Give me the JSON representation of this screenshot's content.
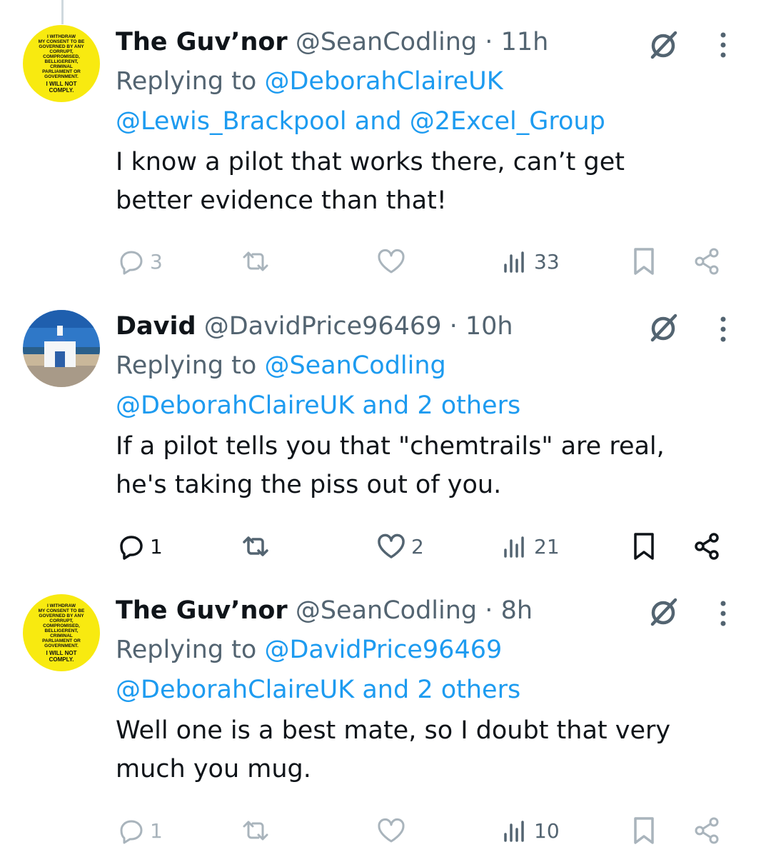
{
  "tweets": [
    {
      "avatar": {
        "lines": [
          "I WITHDRAW",
          "MY CONSENT TO BE",
          "GOVERNED BY ANY",
          "CORRUPT, COMPROMISED,",
          "BELLIGERENT, CRIMINAL",
          "PARLIAMENT OR",
          "GOVERNMENT."
        ],
        "footer": [
          "I WILL NOT",
          "COMPLY."
        ]
      },
      "name": "The Guv’nor",
      "handle": "@SeanCodling",
      "separator": "·",
      "time": "11h",
      "reply_prefix": "Replying to",
      "reply_line1": "@DeborahClaireUK",
      "reply_line2_a": "@Lewis_Brackpool",
      "reply_line2_and": "and",
      "reply_line2_b": "@2Excel_Group",
      "body_lines": [
        "I know a pilot that works there, can’t get",
        "better evidence than that!"
      ],
      "replies": "3",
      "retweets": "",
      "likes": "",
      "views": "33"
    },
    {
      "name": "David",
      "handle": "@DavidPrice96469",
      "separator": "·",
      "time": "10h",
      "reply_prefix": "Replying to",
      "reply_line1": "@SeanCodling",
      "reply_line2_a": "@DeborahClaireUK",
      "reply_line2_and": "and 2 others",
      "body_lines": [
        "If a pilot tells you that \"chemtrails\" are real,",
        "he's taking the piss out of you."
      ],
      "replies": "1",
      "retweets": "",
      "likes": "2",
      "views": "21"
    },
    {
      "avatar": {
        "lines": [
          "I WITHDRAW",
          "MY CONSENT TO BE",
          "GOVERNED BY ANY",
          "CORRUPT, COMPROMISED,",
          "BELLIGERENT, CRIMINAL",
          "PARLIAMENT OR",
          "GOVERNMENT."
        ],
        "footer": [
          "I WILL NOT",
          "COMPLY."
        ]
      },
      "name": "The Guv’nor",
      "handle": "@SeanCodling",
      "separator": "·",
      "time": "8h",
      "reply_prefix": "Replying to",
      "reply_line1": "@DavidPrice96469",
      "reply_line2_a": "@DeborahClaireUK",
      "reply_line2_and": "and 2 others",
      "body_lines": [
        "Well one is a best mate, so I doubt that very",
        "much you mug."
      ],
      "replies": "1",
      "retweets": "",
      "likes": "",
      "views": "10"
    }
  ],
  "colors": {
    "text": "#0f1419",
    "secondary": "#536471",
    "link": "#1d9bf0",
    "avatar_yellow": "#f8ea10"
  },
  "icons": [
    "grok-icon",
    "more-icon",
    "reply-icon",
    "retweet-icon",
    "like-icon",
    "views-icon",
    "bookmark-icon",
    "share-icon"
  ]
}
